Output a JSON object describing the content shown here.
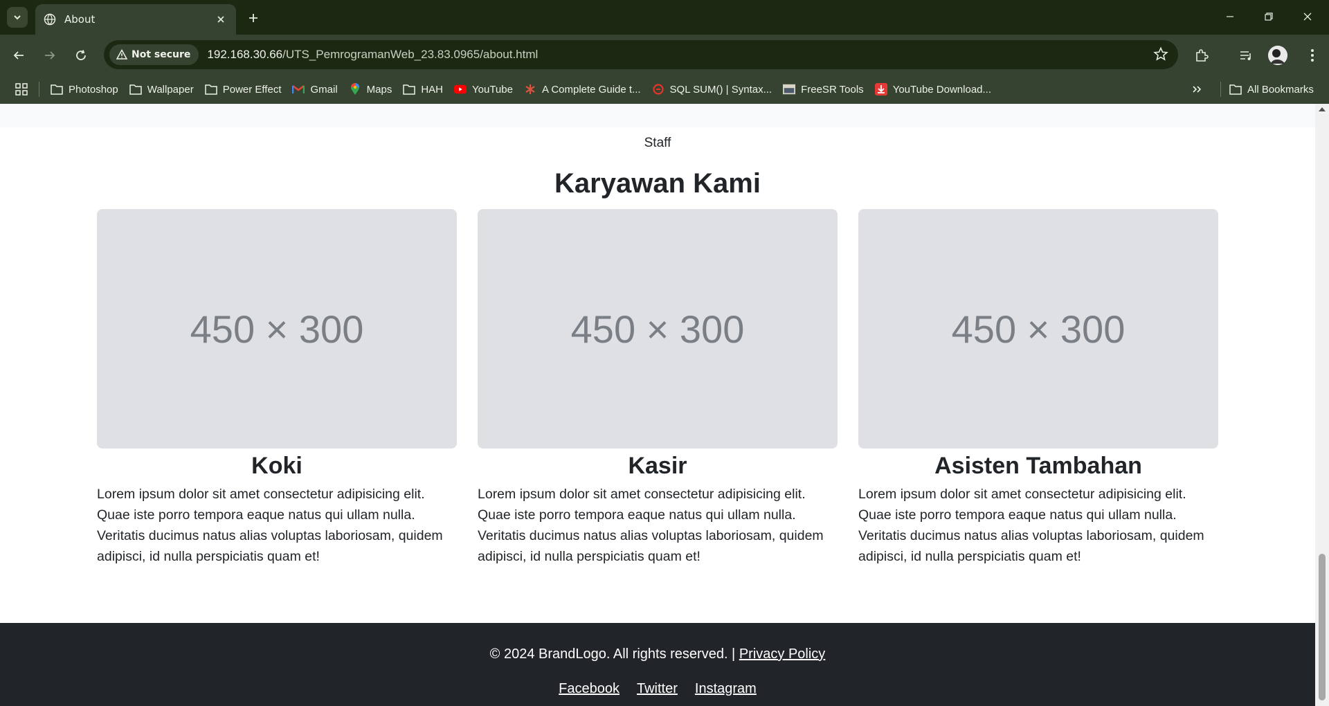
{
  "browser": {
    "tab_title": "About",
    "security_label": "Not secure",
    "url_host": "192.168.30.66",
    "url_path": "/UTS_PemrogramanWeb_23.83.0965/about.html",
    "bookmarks": [
      {
        "label": "Photoshop",
        "icon": "folder-icon"
      },
      {
        "label": "Wallpaper",
        "icon": "folder-icon"
      },
      {
        "label": "Power Effect",
        "icon": "folder-icon"
      },
      {
        "label": "Gmail",
        "icon": "gmail-icon"
      },
      {
        "label": "Maps",
        "icon": "maps-icon"
      },
      {
        "label": "HAH",
        "icon": "folder-icon"
      },
      {
        "label": "YouTube",
        "icon": "youtube-icon"
      },
      {
        "label": "A Complete Guide t...",
        "icon": "asterisk-icon"
      },
      {
        "label": "SQL SUM() | Syntax...",
        "icon": "sql-site-icon"
      },
      {
        "label": "FreeSR Tools",
        "icon": "freesr-icon"
      },
      {
        "label": "YouTube Download...",
        "icon": "download-icon"
      }
    ],
    "all_bookmarks_label": "All Bookmarks"
  },
  "page": {
    "section_subtitle": "Staff",
    "section_title": "Karyawan Kami",
    "cards": [
      {
        "image_label": "450 × 300",
        "title": "Koki",
        "text": "Lorem ipsum dolor sit amet consectetur adipisicing elit. Quae iste porro tempora eaque natus qui ullam nulla. Veritatis ducimus natus alias voluptas laboriosam, quidem adipisci, id nulla perspiciatis quam et!"
      },
      {
        "image_label": "450 × 300",
        "title": "Kasir",
        "text": "Lorem ipsum dolor sit amet consectetur adipisicing elit. Quae iste porro tempora eaque natus qui ullam nulla. Veritatis ducimus natus alias voluptas laboriosam, quidem adipisci, id nulla perspiciatis quam et!"
      },
      {
        "image_label": "450 × 300",
        "title": "Asisten Tambahan",
        "text": "Lorem ipsum dolor sit amet consectetur adipisicing elit. Quae iste porro tempora eaque natus qui ullam nulla. Veritatis ducimus natus alias voluptas laboriosam, quidem adipisci, id nulla perspiciatis quam et!"
      }
    ]
  },
  "footer": {
    "copyright": "© 2024 BrandLogo. All rights reserved. |",
    "privacy_link": "Privacy Policy",
    "social_links": [
      "Facebook",
      "Twitter",
      "Instagram"
    ]
  },
  "colors": {
    "chrome_dark": "#1d2813",
    "chrome_mid": "#364330",
    "footer_bg": "#212529",
    "placeholder_bg": "#dee0e4"
  }
}
